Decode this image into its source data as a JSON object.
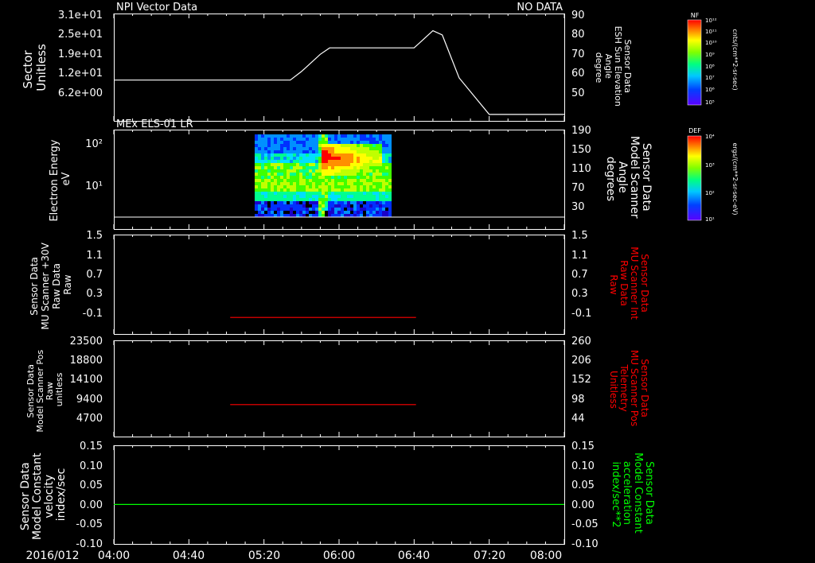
{
  "date_label": "2016/012",
  "time_ticks": [
    "04:00",
    "04:40",
    "05:20",
    "06:00",
    "06:40",
    "07:20",
    "08:00"
  ],
  "colors": {
    "white": "#ffffff",
    "red": "#ff0000",
    "green": "#00ff00",
    "bg": "#000000"
  },
  "chart_data": [
    {
      "type": "line",
      "title": "NPI Vector Data",
      "status": "NO DATA",
      "ylabel_left": [
        "Sector",
        "Unitless"
      ],
      "yticks_left": [
        "3.1e+01",
        "2.5e+01",
        "1.9e+01",
        "1.2e+01",
        "6.2e+00"
      ],
      "ylabel_right": [
        "Sensor Data",
        "ESH Sun Elevation",
        "Angle",
        "degree"
      ],
      "yticks_right": [
        "90",
        "80",
        "70",
        "60",
        "50"
      ],
      "ylim_right": [
        40,
        90
      ],
      "series": [
        {
          "color": "#ffffff",
          "x_minutes": [
            0,
            60,
            86,
            94,
            100,
            110,
            115,
            120,
            125,
            135,
            150,
            160,
            165,
            170,
            175,
            184,
            200,
            210,
            240
          ],
          "y": [
            59,
            59,
            59,
            59,
            63,
            71,
            74,
            74,
            74,
            74,
            74,
            74,
            78,
            82,
            80,
            60,
            43,
            43,
            43
          ]
        }
      ]
    },
    {
      "type": "heatmap",
      "title": "MEx ELS-01 LR",
      "ylabel_left": [
        "Electron Energy",
        "eV"
      ],
      "yticks_left": [
        "10²",
        "10¹"
      ],
      "ylabel_right": [
        "Sensor Data",
        "Model Scanner",
        "Angle",
        "degrees"
      ],
      "yticks_right": [
        "190",
        "150",
        "110",
        "70",
        "30"
      ],
      "colorbar_label": "DEF",
      "colorbar_units": "ergs/(cm**2-sr-sec-eV)"
    },
    {
      "type": "line",
      "ylabel_left": [
        "Sensor Data",
        "MU Scanner +30V",
        "Raw Data",
        "Raw"
      ],
      "yticks_left": [
        "1.5",
        "1.1",
        "0.7",
        "0.3",
        "-0.1"
      ],
      "ylabel_right": [
        "Sensor Data",
        "MU Scanner Int",
        "Raw Data",
        "Raw"
      ],
      "yticks_right": [
        "1.5",
        "1.1",
        "0.7",
        "0.3",
        "-0.1"
      ],
      "ylim": [
        -0.3,
        1.5
      ],
      "series": [
        {
          "color": "#ff0000",
          "x_minutes": [
            62,
            161
          ],
          "y": [
            0.0,
            0.0
          ]
        }
      ]
    },
    {
      "type": "line",
      "ylabel_left": [
        "Sensor Data",
        "Model Scanner Pos",
        "Raw",
        "unitless"
      ],
      "yticks_left": [
        "23500",
        "18800",
        "14100",
        "9400",
        "4700"
      ],
      "ylabel_right": [
        "Sensor Data",
        "MU Scanner Pos",
        "Telemetry",
        "Unitless"
      ],
      "yticks_right": [
        "260",
        "206",
        "152",
        "98",
        "44"
      ],
      "ylim": [
        0,
        23500
      ],
      "series": [
        {
          "color": "#ff0000",
          "x_minutes": [
            62,
            161
          ],
          "y": [
            7800,
            7800
          ]
        }
      ]
    },
    {
      "type": "line",
      "ylabel_left": [
        "Sensor Data",
        "Model Constant",
        "velocity",
        "index/sec"
      ],
      "yticks_left": [
        "0.15",
        "0.10",
        "0.05",
        "0.00",
        "-0.05",
        "-0.10"
      ],
      "ylabel_right": [
        "Sensor Data",
        "Model Constant",
        "acceleration",
        "index/sec**2"
      ],
      "yticks_right": [
        "0.15",
        "0.10",
        "0.05",
        "0.00",
        "-0.05",
        "-0.10"
      ],
      "ylim": [
        -0.1,
        0.15
      ],
      "series": [
        {
          "color": "#00ff00",
          "x_minutes": [
            0,
            240
          ],
          "y": [
            0.0,
            0.0
          ]
        }
      ]
    }
  ],
  "colorbars": [
    {
      "label": "NF",
      "units": "cnts/(cm**2-sr-sec)",
      "ticks": [
        "10¹²",
        "10¹¹",
        "10¹⁰",
        "10⁹",
        "10⁸",
        "10⁷",
        "10⁶",
        "10⁵"
      ]
    },
    {
      "label": "DEF",
      "units": "ergs/(cm**2-sr-sec-eV)",
      "ticks": [
        "10⁴",
        "10³",
        "10²",
        "10¹"
      ]
    }
  ]
}
